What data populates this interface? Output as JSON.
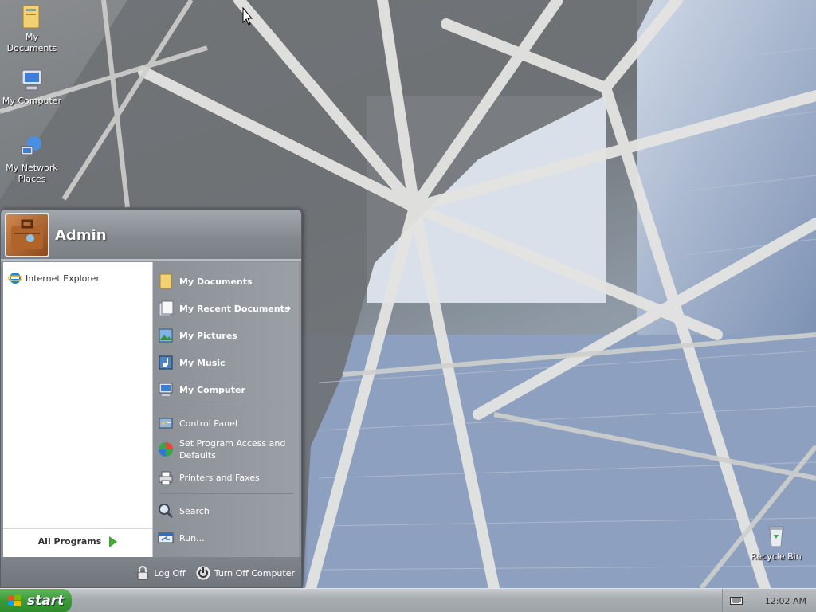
{
  "desktop": {
    "icons": [
      {
        "label": "My Documents"
      },
      {
        "label": "My Computer"
      },
      {
        "label": "My Network Places"
      },
      {
        "label": "Recycle Bin"
      }
    ]
  },
  "start_menu": {
    "username": "Admin",
    "pinned": [
      {
        "label": "Internet Explorer"
      }
    ],
    "all_programs_label": "All Programs",
    "right_items": [
      {
        "label": "My Documents",
        "bold": true
      },
      {
        "label": "My Recent Documents",
        "bold": true,
        "submenu": true
      },
      {
        "label": "My Pictures",
        "bold": true
      },
      {
        "label": "My Music",
        "bold": true
      },
      {
        "label": "My Computer",
        "bold": true
      },
      {
        "label": "Control Panel",
        "bold": false
      },
      {
        "label": "Set Program Access and Defaults",
        "bold": false
      },
      {
        "label": "Printers and Faxes",
        "bold": false
      },
      {
        "label": "Search",
        "bold": false
      },
      {
        "label": "Run...",
        "bold": false
      }
    ],
    "footer": {
      "log_off": "Log Off",
      "turn_off": "Turn Off Computer"
    }
  },
  "taskbar": {
    "start_label": "start",
    "clock": "12:02 AM"
  },
  "colors": {
    "start_green": "#3a9a36",
    "menu_gray": "#8e939a",
    "all_programs_arrow": "#3daa32"
  }
}
